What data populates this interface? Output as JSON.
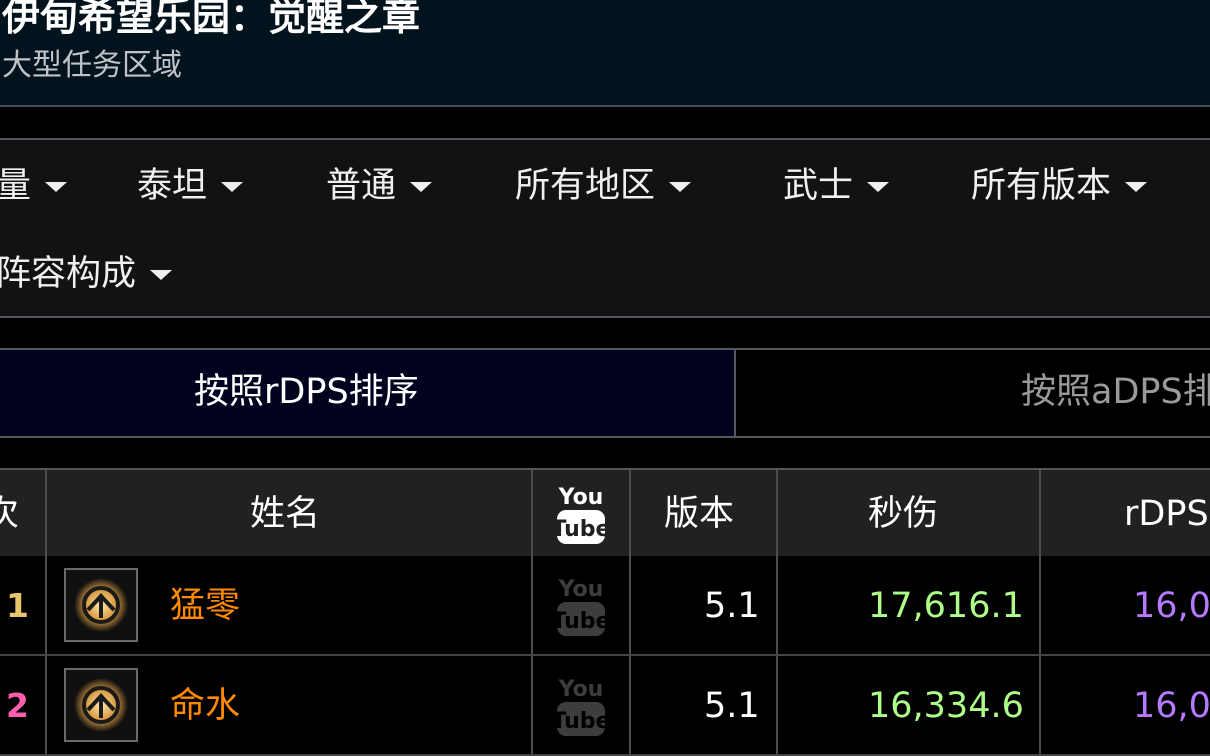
{
  "header": {
    "title": "伊甸希望乐园：觉醒之章",
    "subtitle": "大型任务区域"
  },
  "filters": [
    {
      "label": "量"
    },
    {
      "label": "泰坦"
    },
    {
      "label": "普通"
    },
    {
      "label": "所有地区"
    },
    {
      "label": "武士"
    },
    {
      "label": "所有版本"
    },
    {
      "label": "阵容构成"
    }
  ],
  "sort": {
    "active_label": "按照rDPS排序",
    "inactive_label": "按照aDPS排"
  },
  "table": {
    "columns": {
      "rank": "次",
      "name": "姓名",
      "youtube": "YouTube",
      "version": "版本",
      "dps": "秒伤",
      "rdps": "rDPS"
    },
    "rows": [
      {
        "rank": "1",
        "name": "猛零",
        "version": "5.1",
        "dps": "17,616.1",
        "rdps": "16,0"
      },
      {
        "rank": "2",
        "name": "命水",
        "version": "5.1",
        "dps": "16,334.6",
        "rdps": "16,0"
      }
    ]
  },
  "colors": {
    "rank_1": "#e8c46a",
    "rank_2": "#ff5eb0",
    "name": "#ff8a00",
    "dps": "#aeff8a",
    "rdps": "#b57aff"
  }
}
